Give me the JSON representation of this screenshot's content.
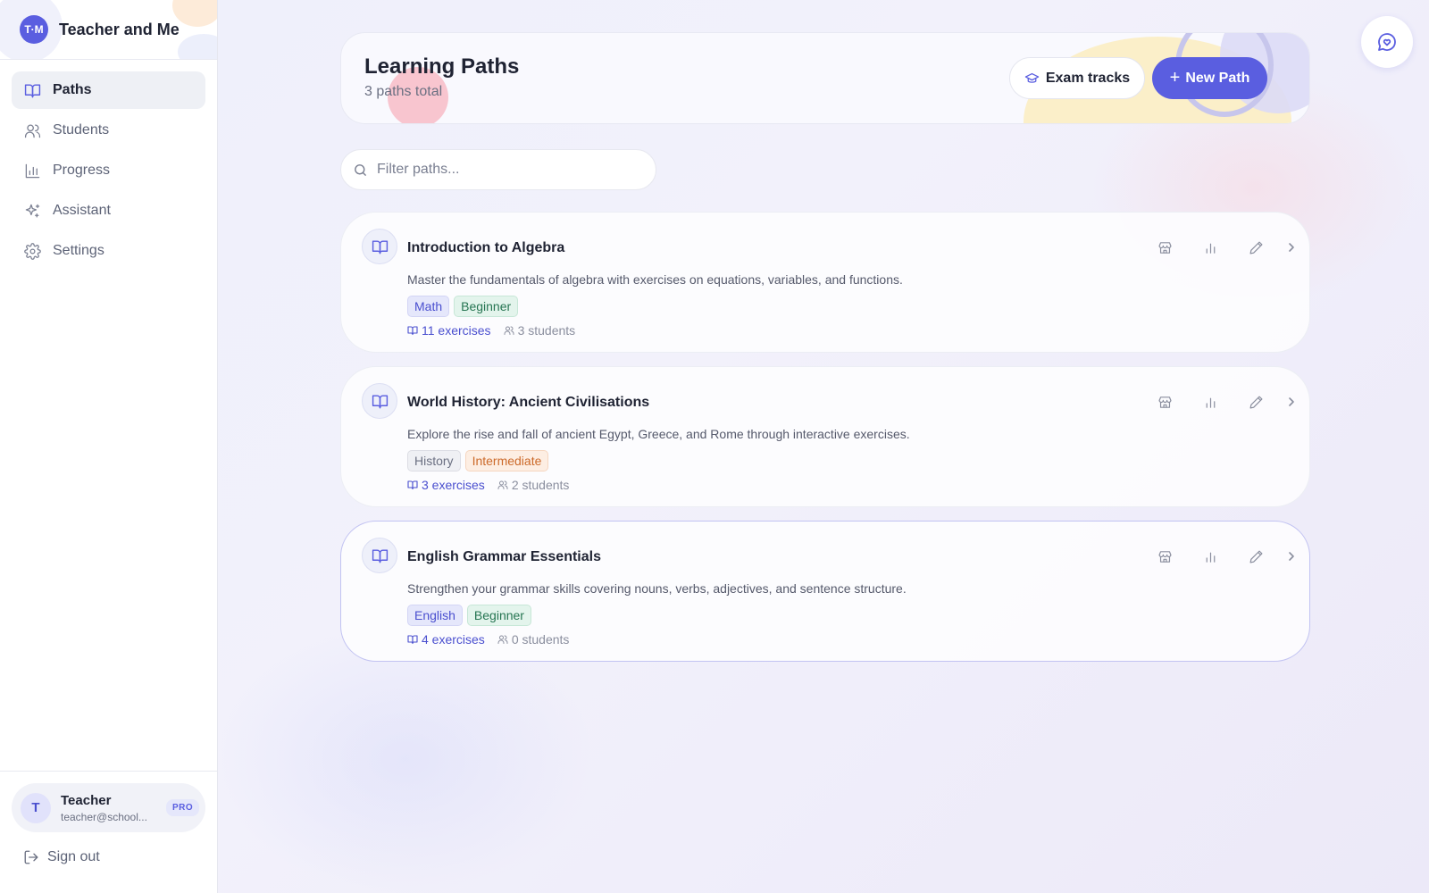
{
  "brand": {
    "logo_text": "T·M",
    "name": "Teacher and Me"
  },
  "nav": {
    "items": [
      {
        "label": "Paths",
        "icon": "book-open-icon",
        "active": true
      },
      {
        "label": "Students",
        "icon": "users-icon",
        "active": false
      },
      {
        "label": "Progress",
        "icon": "bar-chart-icon",
        "active": false
      },
      {
        "label": "Assistant",
        "icon": "sparkles-icon",
        "active": false
      },
      {
        "label": "Settings",
        "icon": "gear-icon",
        "active": false
      }
    ]
  },
  "user": {
    "initial": "T",
    "name": "Teacher",
    "email": "teacher@school...",
    "plan_badge": "PRO",
    "signout_label": "Sign out"
  },
  "header": {
    "title": "Learning Paths",
    "subtitle": "3 paths total",
    "exam_button": "Exam tracks",
    "new_button_plus": "+",
    "new_button": "New Path"
  },
  "search": {
    "placeholder": "Filter paths..."
  },
  "colors": {
    "accent": "#5a5ee0",
    "tag_blue": "#4a4fcf",
    "tag_green": "#267552",
    "tag_orange": "#cc6a2a"
  },
  "paths": [
    {
      "title": "Introduction to Algebra",
      "description": "Master the fundamentals of algebra with exercises on equations, variables, and functions.",
      "tags": [
        {
          "label": "Math",
          "style": "blue"
        },
        {
          "label": "Beginner",
          "style": "green"
        }
      ],
      "exercises": "11 exercises",
      "students": "3 students",
      "selected": false
    },
    {
      "title": "World History: Ancient Civilisations",
      "description": "Explore the rise and fall of ancient Egypt, Greece, and Rome through interactive exercises.",
      "tags": [
        {
          "label": "History",
          "style": "gray"
        },
        {
          "label": "Intermediate",
          "style": "orange"
        }
      ],
      "exercises": "3 exercises",
      "students": "2 students",
      "selected": false
    },
    {
      "title": "English Grammar Essentials",
      "description": "Strengthen your grammar skills covering nouns, verbs, adjectives, and sentence structure.",
      "tags": [
        {
          "label": "English",
          "style": "blue"
        },
        {
          "label": "Beginner",
          "style": "green"
        }
      ],
      "exercises": "4 exercises",
      "students": "0 students",
      "selected": true
    }
  ]
}
